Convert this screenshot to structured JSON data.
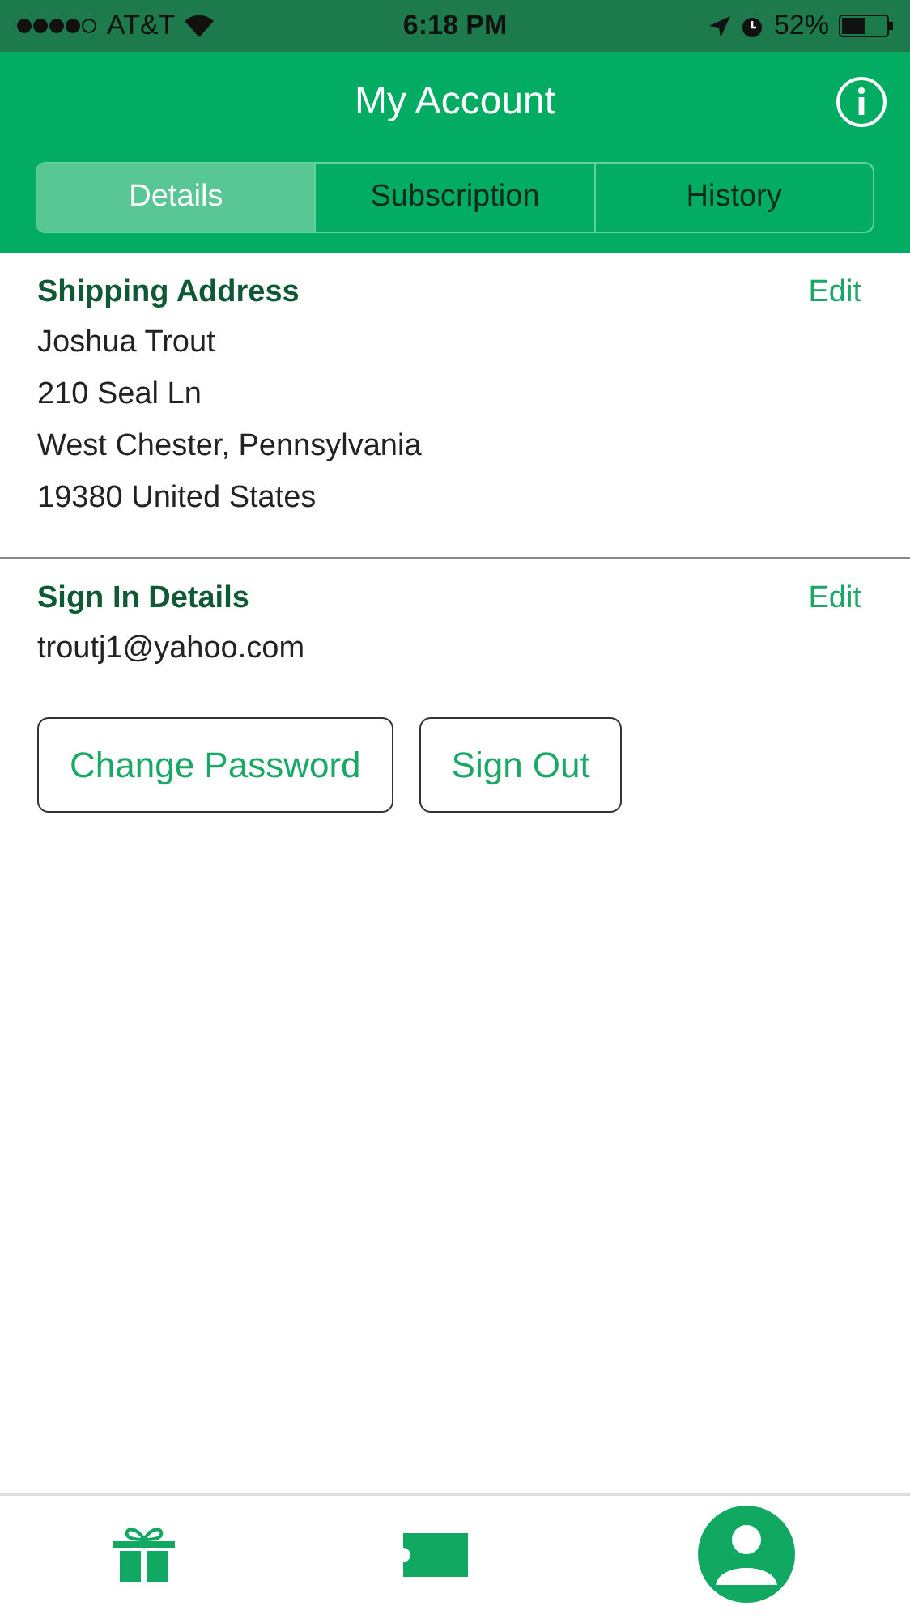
{
  "status_bar": {
    "carrier": "AT&T",
    "time": "6:18 PM",
    "battery": "52%"
  },
  "nav": {
    "title": "My Account"
  },
  "tabs": [
    {
      "label": "Details",
      "selected": true
    },
    {
      "label": "Subscription",
      "selected": false
    },
    {
      "label": "History",
      "selected": false
    }
  ],
  "sections": [
    {
      "title": "Shipping Address",
      "action": "Edit",
      "lines": [
        "Joshua Trout",
        "210 Seal Ln",
        "West Chester, Pennsylvania",
        "19380 United States"
      ]
    },
    {
      "title": "Sign In Details",
      "action": "Edit",
      "lines": [
        "troutj1@yahoo.com"
      ],
      "buttons": [
        "Change Password",
        "Sign Out"
      ]
    }
  ]
}
